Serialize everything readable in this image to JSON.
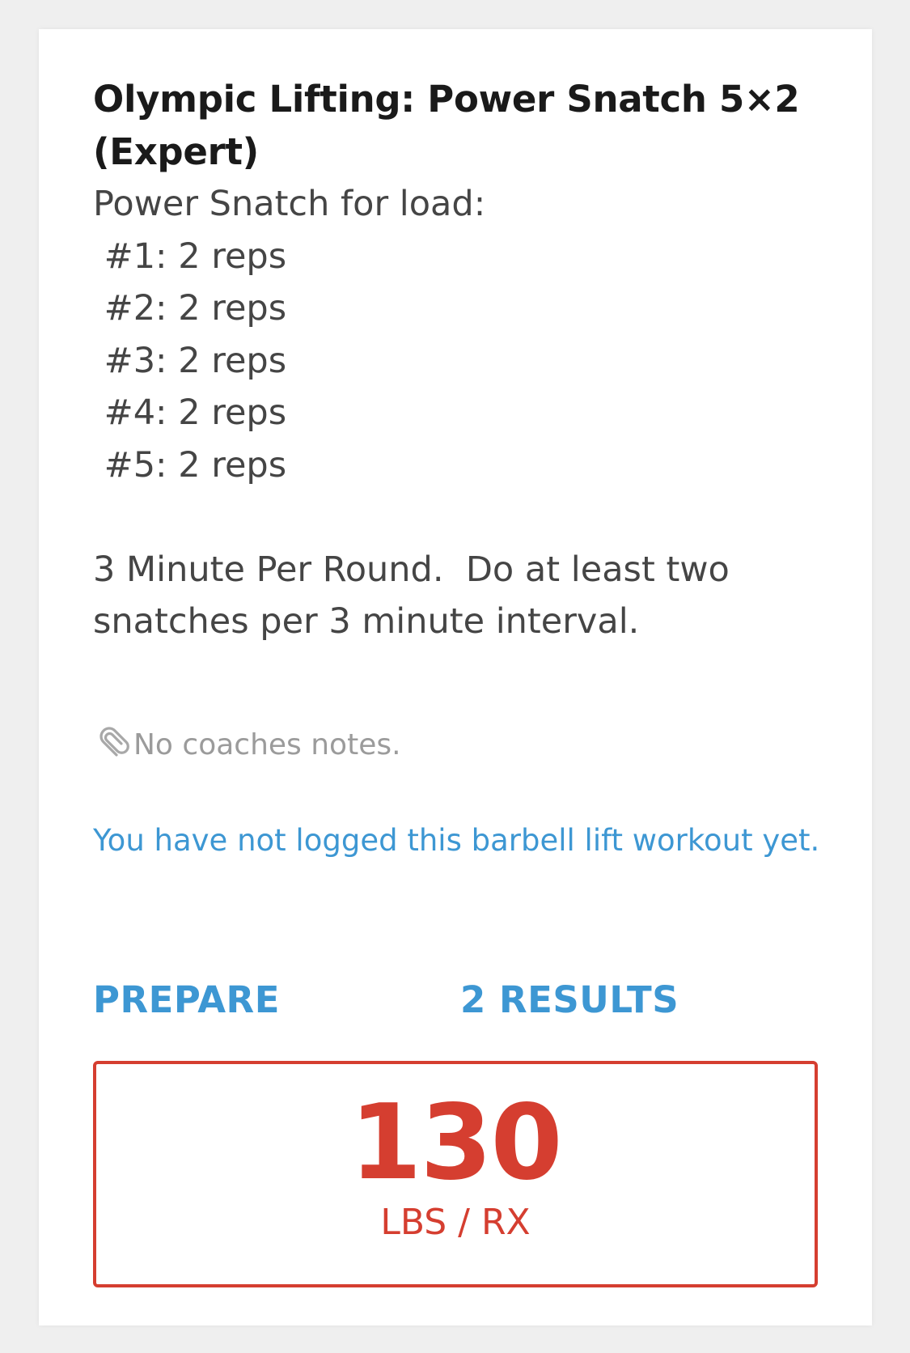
{
  "workout": {
    "title": "Olympic Lifting: Power Snatch 5×2 (Expert)",
    "description_lines": [
      "Power Snatch for load:",
      " #1: 2 reps",
      " #2: 2 reps",
      " #3: 2 reps",
      " #4: 2 reps",
      " #5: 2 reps"
    ],
    "instructions": "3 Minute Per Round.  Do at least two snatches per 3 minute interval.",
    "coach_notes": "No coaches notes.",
    "coach_notes_icon": "paperclip-icon",
    "log_status": "You have not logged this barbell lift workout yet."
  },
  "actions": {
    "prepare_label": "PREPARE",
    "results_label": "2 RESULTS"
  },
  "result": {
    "value": "130",
    "unit": "LBS / RX"
  },
  "colors": {
    "accent_blue": "#3d97d3",
    "result_red": "#d53e30",
    "title_text": "#1a1a1a",
    "body_text": "#454545",
    "muted_text": "#9b9b9b",
    "page_background": "#efefef",
    "card_background": "#ffffff"
  }
}
